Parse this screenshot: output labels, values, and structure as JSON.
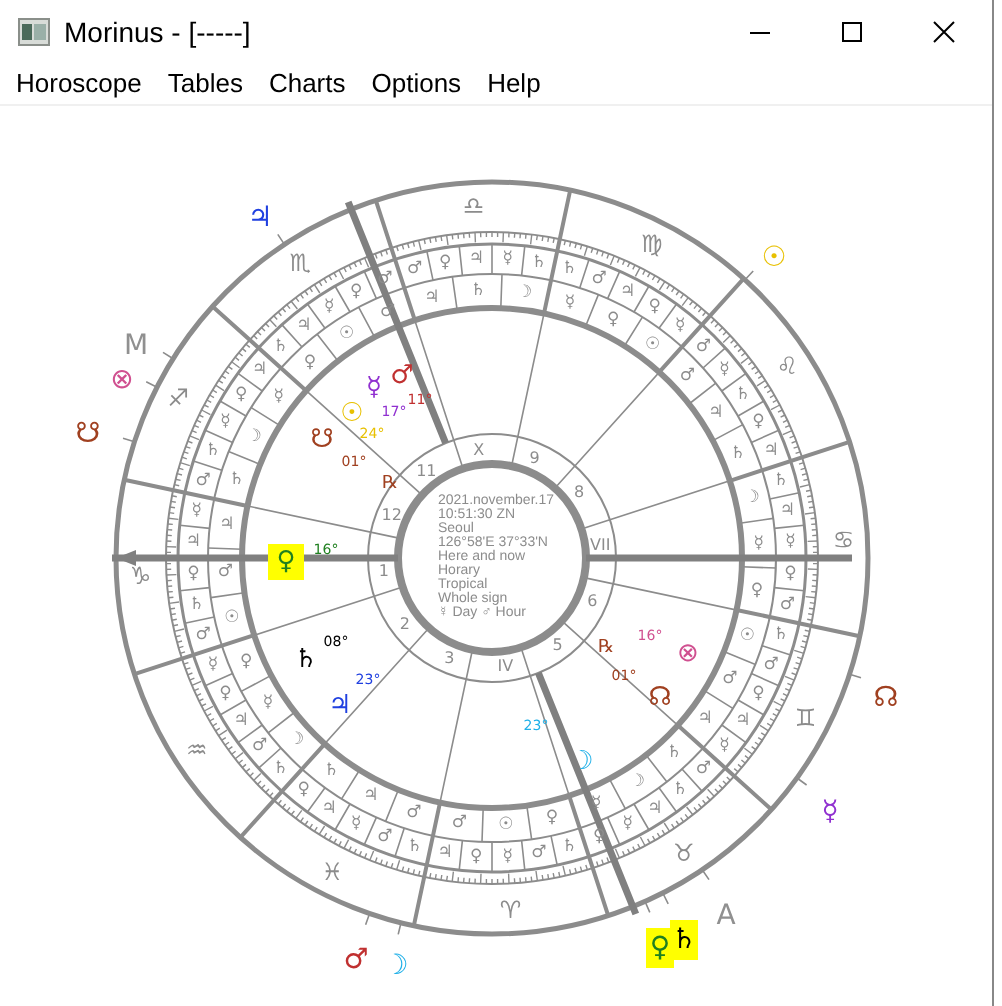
{
  "window": {
    "title": "Morinus - [-----]"
  },
  "menu": [
    "Horoscope",
    "Tables",
    "Charts",
    "Options",
    "Help"
  ],
  "chart": {
    "signs": [
      "♈",
      "♉",
      "♊",
      "♋",
      "♌",
      "♍",
      "♎",
      "♏",
      "♐",
      "♑",
      "♒",
      "♓"
    ],
    "terms": [
      [
        "♃",
        "♀",
        "☿",
        "♂",
        "♄"
      ],
      [
        "♀",
        "☿",
        "♃",
        "♄",
        "♂"
      ],
      [
        "♄",
        "♂",
        "♀",
        "♃",
        "☿"
      ],
      [
        "♄",
        "♃",
        "☿",
        "♀",
        "♂"
      ],
      [
        "♂",
        "☿",
        "♄",
        "♀",
        "♃"
      ],
      [
        "♄",
        "♂",
        "♃",
        "♀",
        "☿"
      ],
      [
        "♂",
        "♀",
        "♃",
        "☿",
        "♄"
      ],
      [
        "♄",
        "♃",
        "☿",
        "♀",
        "♂"
      ],
      [
        "♃",
        "♀",
        "☿",
        "♄",
        "♂"
      ],
      [
        "☿",
        "♃",
        "♀",
        "♄",
        "♂"
      ],
      [
        "☿",
        "♀",
        "♃",
        "♂",
        "♄"
      ],
      [
        "♀",
        "♃",
        "☿",
        "♂",
        "♄"
      ]
    ],
    "faces": [
      [
        "♂",
        "☉",
        "♀"
      ],
      [
        "☿",
        "☽",
        "♄"
      ],
      [
        "☉",
        "♂",
        "♃"
      ],
      [
        "☽",
        "☿",
        "♀"
      ],
      [
        "♂",
        "♃",
        "♄"
      ],
      [
        "☿",
        "♀",
        "☉"
      ],
      [
        "♃",
        "♄",
        "☽"
      ],
      [
        "♀",
        "☉",
        "♂"
      ],
      [
        "☿",
        "☽",
        "♄"
      ],
      [
        "♃",
        "♂",
        "☉"
      ],
      [
        "♀",
        "☿",
        "☽"
      ],
      [
        "♄",
        "♃",
        "♂"
      ]
    ],
    "houses": [
      "1",
      "2",
      "3",
      "IV",
      "5",
      "6",
      "VII",
      "8",
      "9",
      "X",
      "11",
      "12"
    ],
    "info": [
      "2021.november.17",
      "10:51:30 ZN",
      "Seoul",
      "126°58'E  37°33'N",
      "Here and now",
      "Horary",
      "Tropical",
      "Whole sign"
    ],
    "day_ruler": {
      "glyph": "☿",
      "label": "Day"
    },
    "hour_ruler": {
      "glyph": "♂",
      "label": "Hour"
    },
    "planets": [
      {
        "glyph": "♂",
        "color": "#c03030",
        "degree": "11°",
        "retrograde": false,
        "highlighted": false
      },
      {
        "glyph": "☿",
        "color": "#9030d0",
        "degree": "17°",
        "retrograde": false,
        "highlighted": false
      },
      {
        "glyph": "☉",
        "color": "#e8c000",
        "degree": "24°",
        "retrograde": false,
        "highlighted": false
      },
      {
        "glyph": "☋",
        "color": "#a04020",
        "degree": "01°",
        "retrograde": true,
        "highlighted": false
      },
      {
        "glyph": "♀",
        "color": "#208020",
        "degree": "16°",
        "retrograde": false,
        "highlighted": true
      },
      {
        "glyph": "♄",
        "color": "#000000",
        "degree": "08°",
        "retrograde": false,
        "highlighted": false
      },
      {
        "glyph": "♃",
        "color": "#2040e0",
        "degree": "23°",
        "retrograde": false,
        "highlighted": false
      },
      {
        "glyph": "☽",
        "color": "#20b0e8",
        "degree": "23°",
        "retrograde": false,
        "highlighted": false
      },
      {
        "glyph": "⊗",
        "color": "#d05090",
        "degree": "16°",
        "retrograde": false,
        "highlighted": false
      },
      {
        "glyph": "☊",
        "color": "#a04020",
        "degree": "01°",
        "retrograde": true,
        "highlighted": false
      }
    ],
    "retrograde_mark": "℞",
    "outer_points": [
      {
        "glyph": "♃",
        "color": "#2040e0",
        "highlighted": false
      },
      {
        "glyph": "M",
        "color": "#909090",
        "highlighted": false
      },
      {
        "glyph": "⊗",
        "color": "#d05090",
        "highlighted": false
      },
      {
        "glyph": "☋",
        "color": "#a04020",
        "highlighted": false
      },
      {
        "glyph": "☉",
        "color": "#e8c000",
        "highlighted": false
      },
      {
        "glyph": "☊",
        "color": "#a04020",
        "highlighted": false
      },
      {
        "glyph": "☿",
        "color": "#9030d0",
        "highlighted": false
      },
      {
        "glyph": "A",
        "color": "#909090",
        "highlighted": false
      },
      {
        "glyph": "♀",
        "color": "#208020",
        "highlighted": true
      },
      {
        "glyph": "♄",
        "color": "#000000",
        "highlighted": true
      },
      {
        "glyph": "♂",
        "color": "#c03030",
        "highlighted": false
      },
      {
        "glyph": "☽",
        "color": "#20b0e8",
        "highlighted": false
      }
    ]
  }
}
